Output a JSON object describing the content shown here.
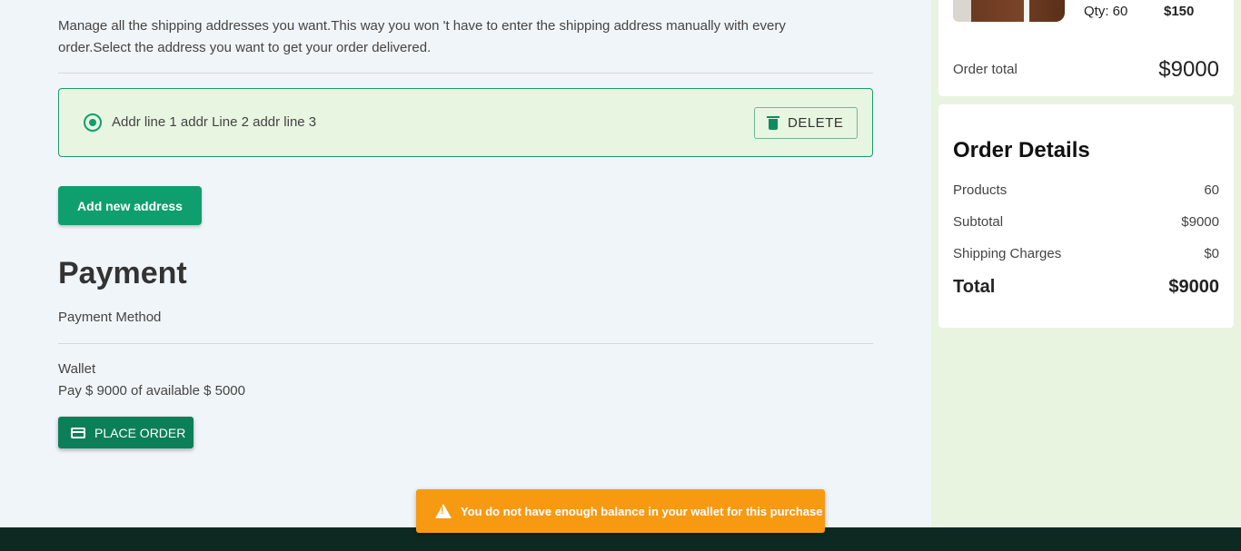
{
  "address_section": {
    "intro": "Manage all the shipping addresses you want.This way you won 't have to enter the shipping address manually with every order.Select the address you want to get your order delivered.",
    "address": "Addr line 1 addr Line 2 addr line 3",
    "delete_label": "DELETE",
    "add_label": "Add new address"
  },
  "payment": {
    "title": "Payment",
    "method_label": "Payment Method",
    "method": "Wallet",
    "info": "Pay $ 9000 of available $ 5000",
    "place_order_label": "PLACE ORDER"
  },
  "cart": {
    "qty": "Qty: 60",
    "price": "$150",
    "order_total_label": "Order total",
    "order_total": "$9000"
  },
  "order_details": {
    "title": "Order Details",
    "rows": [
      {
        "label": "Products",
        "value": "60"
      },
      {
        "label": "Subtotal",
        "value": "$9000"
      },
      {
        "label": "Shipping Charges",
        "value": "$0"
      }
    ],
    "total_label": "Total",
    "total": "$9000"
  },
  "toast": {
    "message": "You do not have enough balance in your wallet for this purchase",
    "icon": "warning-icon"
  },
  "colors": {
    "accent": "#0f9f6e",
    "warning": "#f79a12",
    "footer": "#0d2a22"
  }
}
